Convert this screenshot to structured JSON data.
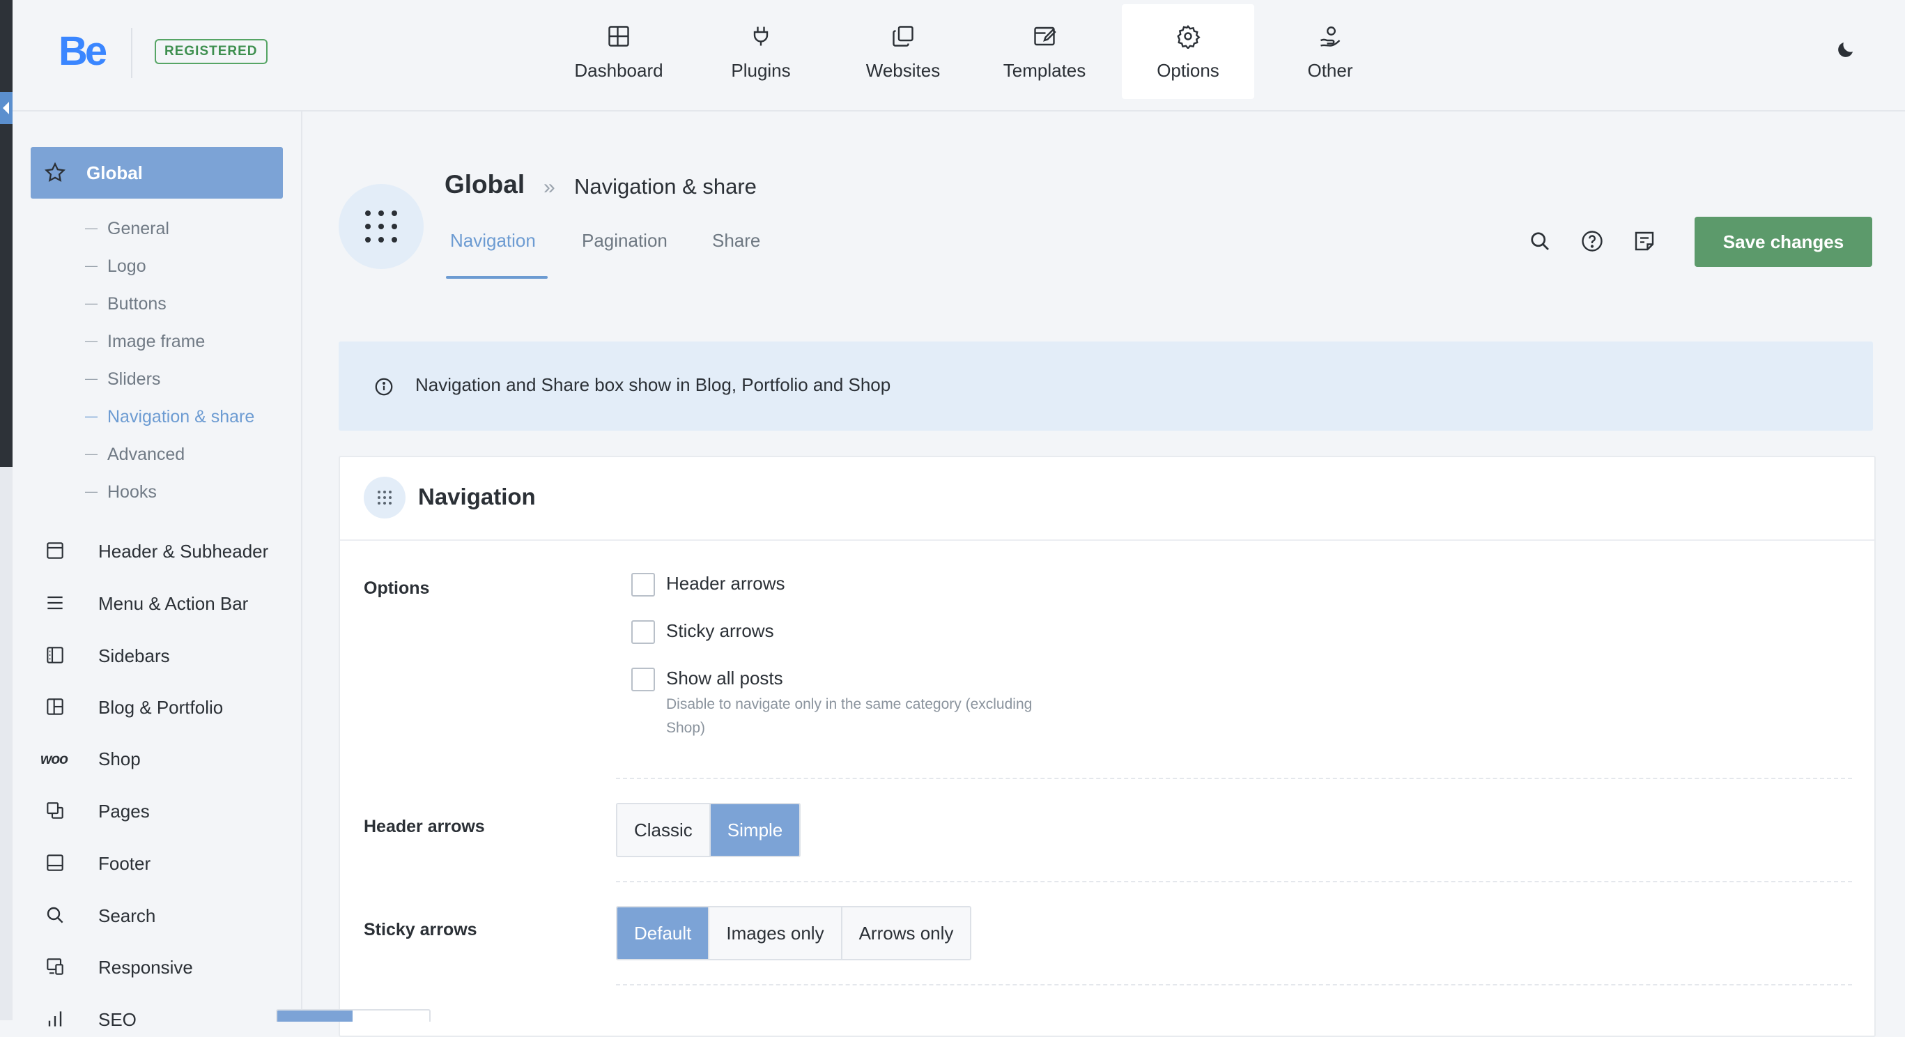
{
  "app": {
    "logo_text": "Be",
    "badge": "REGISTERED",
    "brand_color": "#3a86ff",
    "accent_color": "#7ca3d6",
    "save_color": "#5c9a6b"
  },
  "topnav": [
    {
      "label": "Dashboard",
      "icon": "dashboard-icon"
    },
    {
      "label": "Plugins",
      "icon": "plug-icon"
    },
    {
      "label": "Websites",
      "icon": "websites-icon"
    },
    {
      "label": "Templates",
      "icon": "templates-icon"
    },
    {
      "label": "Options",
      "icon": "gear-icon",
      "active": true
    },
    {
      "label": "Other",
      "icon": "hand-user-icon"
    }
  ],
  "sidebar": {
    "global_label": "Global",
    "sub_items": [
      "General",
      "Logo",
      "Buttons",
      "Image frame",
      "Sliders",
      "Navigation & share",
      "Advanced",
      "Hooks"
    ],
    "active_sub": "Navigation & share",
    "items": [
      {
        "label": "Header & Subheader",
        "icon": "header-icon"
      },
      {
        "label": "Menu & Action Bar",
        "icon": "menu-icon"
      },
      {
        "label": "Sidebars",
        "icon": "sidebar-icon"
      },
      {
        "label": "Blog & Portfolio",
        "icon": "blog-icon"
      },
      {
        "label": "Shop",
        "icon": "woo-icon",
        "icon_text": "woo"
      },
      {
        "label": "Pages",
        "icon": "pages-icon"
      },
      {
        "label": "Footer",
        "icon": "footer-icon"
      },
      {
        "label": "Search",
        "icon": "search-icon"
      },
      {
        "label": "Responsive",
        "icon": "responsive-icon"
      },
      {
        "label": "SEO",
        "icon": "seo-icon"
      }
    ]
  },
  "header": {
    "crumb_parent": "Global",
    "crumb_separator": "»",
    "crumb_current": "Navigation & share",
    "tabs": [
      "Navigation",
      "Pagination",
      "Share"
    ],
    "active_tab": "Navigation",
    "save_label": "Save changes"
  },
  "info": {
    "text": "Navigation and Share box show in Blog, Portfolio and Shop"
  },
  "section": {
    "title": "Navigation",
    "options_label": "Options",
    "checkboxes": [
      {
        "label": "Header arrows",
        "checked": false
      },
      {
        "label": "Sticky arrows",
        "checked": false
      },
      {
        "label": "Show all posts",
        "checked": false
      }
    ],
    "show_all_hint": "Disable to navigate only in the same category (excluding Shop)",
    "header_arrows": {
      "label": "Header arrows",
      "options": [
        "Classic",
        "Simple"
      ],
      "selected": "Simple"
    },
    "sticky_arrows": {
      "label": "Sticky arrows",
      "options": [
        "Default",
        "Images only",
        "Arrows only"
      ],
      "selected": "Default"
    }
  }
}
